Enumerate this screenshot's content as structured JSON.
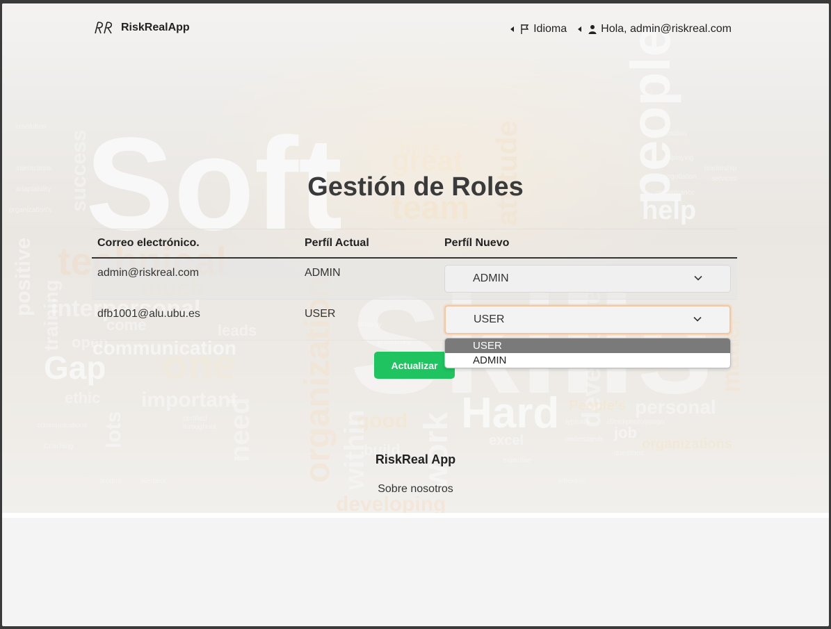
{
  "header": {
    "brand_name": "RiskRealApp",
    "language_label": "Idioma",
    "user_greeting": "Hola, admin@riskreal.com"
  },
  "page": {
    "title": "Gestión de Roles"
  },
  "table": {
    "columns": [
      "Correo electrónico.",
      "Perfíl Actual",
      "Perfíl Nuevo"
    ],
    "rows": [
      {
        "email": "admin@riskreal.com",
        "current_role": "ADMIN",
        "new_role": "ADMIN"
      },
      {
        "email": "dfb1001@alu.ubu.es",
        "current_role": "USER",
        "new_role": "USER"
      }
    ]
  },
  "dropdown": {
    "options": [
      "USER",
      "ADMIN"
    ],
    "highlighted": "USER"
  },
  "actions": {
    "update_label": "Actualizar"
  },
  "footer": {
    "title": "RiskReal App",
    "about_link": "Sobre nosotros"
  },
  "colors": {
    "accent_button": "#1fc35f",
    "select_focus_ring": "#f2c7a4"
  }
}
